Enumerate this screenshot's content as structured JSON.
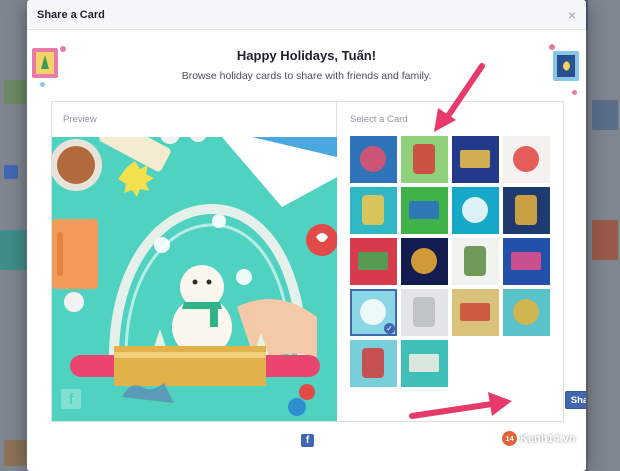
{
  "dialog": {
    "title": "Share a Card",
    "close_label": "×",
    "greeting": "Happy Holidays, Tuấn!",
    "subtitle": "Browse holiday cards to share with friends and family."
  },
  "preview": {
    "label": "Preview",
    "watermark": "f"
  },
  "select": {
    "label": "Select a Card",
    "cards": [
      {
        "name": "card-stars",
        "color": "#2f74b8",
        "accent": "#e84f6a"
      },
      {
        "name": "card-bird",
        "color": "#8fd17a",
        "accent": "#d63b3b"
      },
      {
        "name": "card-window",
        "color": "#233a8c",
        "accent": "#f2c24a"
      },
      {
        "name": "card-santa",
        "color": "#f4f1ee",
        "accent": "#e2433d"
      },
      {
        "name": "card-ornaments",
        "color": "#2fb8c4",
        "accent": "#f4c64a"
      },
      {
        "name": "card-triangles",
        "color": "#3fb24a",
        "accent": "#2a6ec9"
      },
      {
        "name": "card-house",
        "color": "#16a8c8",
        "accent": "#ffffff"
      },
      {
        "name": "card-forest",
        "color": "#1f3a6e",
        "accent": "#e8b33c"
      },
      {
        "name": "card-cactus",
        "color": "#d93b4e",
        "accent": "#3fae54"
      },
      {
        "name": "card-fireworks",
        "color": "#131c4f",
        "accent": "#f2b233"
      },
      {
        "name": "card-snowman-branch",
        "color": "#f2f2f0",
        "accent": "#5b8a3c"
      },
      {
        "name": "card-gifts",
        "color": "#2350a8",
        "accent": "#e84f8a"
      },
      {
        "name": "card-snowglobe",
        "color": "#8ad7e6",
        "accent": "#ffffff",
        "selected": true
      },
      {
        "name": "card-paper",
        "color": "#e3e6e6",
        "accent": "#b8bdbd"
      },
      {
        "name": "card-pattern",
        "color": "#d9c27a",
        "accent": "#c84a3a"
      },
      {
        "name": "card-dreidels",
        "color": "#59c3c9",
        "accent": "#e4b43a"
      },
      {
        "name": "card-train",
        "color": "#78cfd9",
        "accent": "#d23a3a"
      },
      {
        "name": "card-latte",
        "color": "#3fbfb8",
        "accent": "#f5efe3"
      }
    ],
    "check": "✓"
  },
  "actions": {
    "share_label": "Share"
  },
  "footer": {
    "fb_icon": "f"
  },
  "watermark": {
    "badge": "14",
    "text": "Kenh14.vn"
  },
  "colors": {
    "brand": "#4267b2",
    "annotation": "#e8396b"
  }
}
